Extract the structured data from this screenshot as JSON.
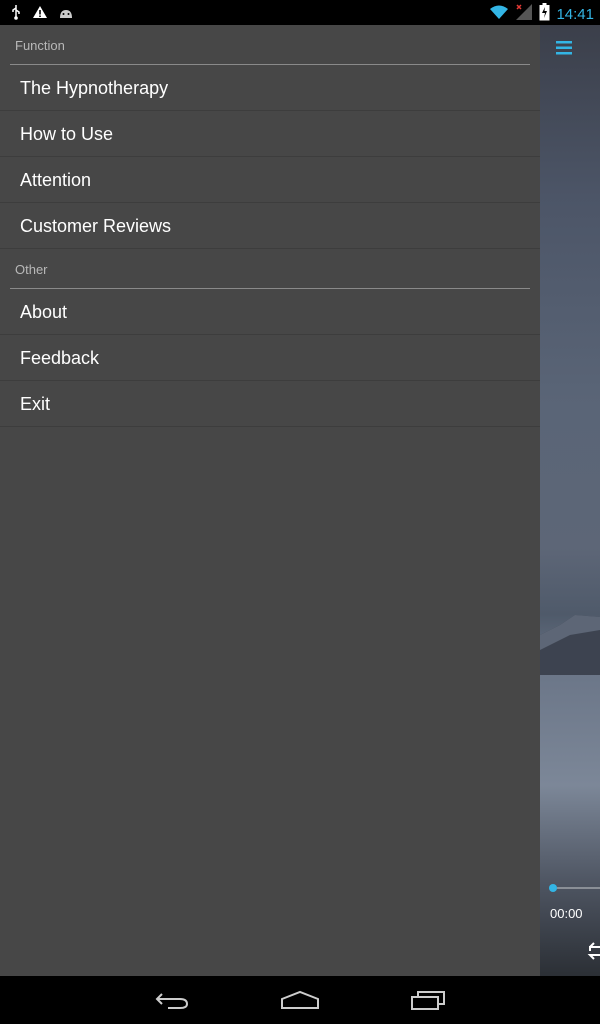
{
  "status_bar": {
    "time": "14:41",
    "icons": [
      "usb-icon",
      "warning-icon",
      "android-icon",
      "wifi-icon",
      "signal-icon",
      "battery-icon"
    ]
  },
  "drawer": {
    "sections": [
      {
        "title": "Function",
        "items": [
          "The Hypnotherapy",
          "How to Use",
          "Attention",
          "Customer Reviews"
        ]
      },
      {
        "title": "Other",
        "items": [
          "About",
          "Feedback",
          "Exit"
        ]
      }
    ]
  },
  "player": {
    "elapsed": "00:00",
    "progress": 0
  },
  "nav_bar": {
    "buttons": [
      "back-icon",
      "home-icon",
      "recents-icon"
    ]
  },
  "colors": {
    "accent": "#33b5e5",
    "drawer_bg": "#474747"
  }
}
